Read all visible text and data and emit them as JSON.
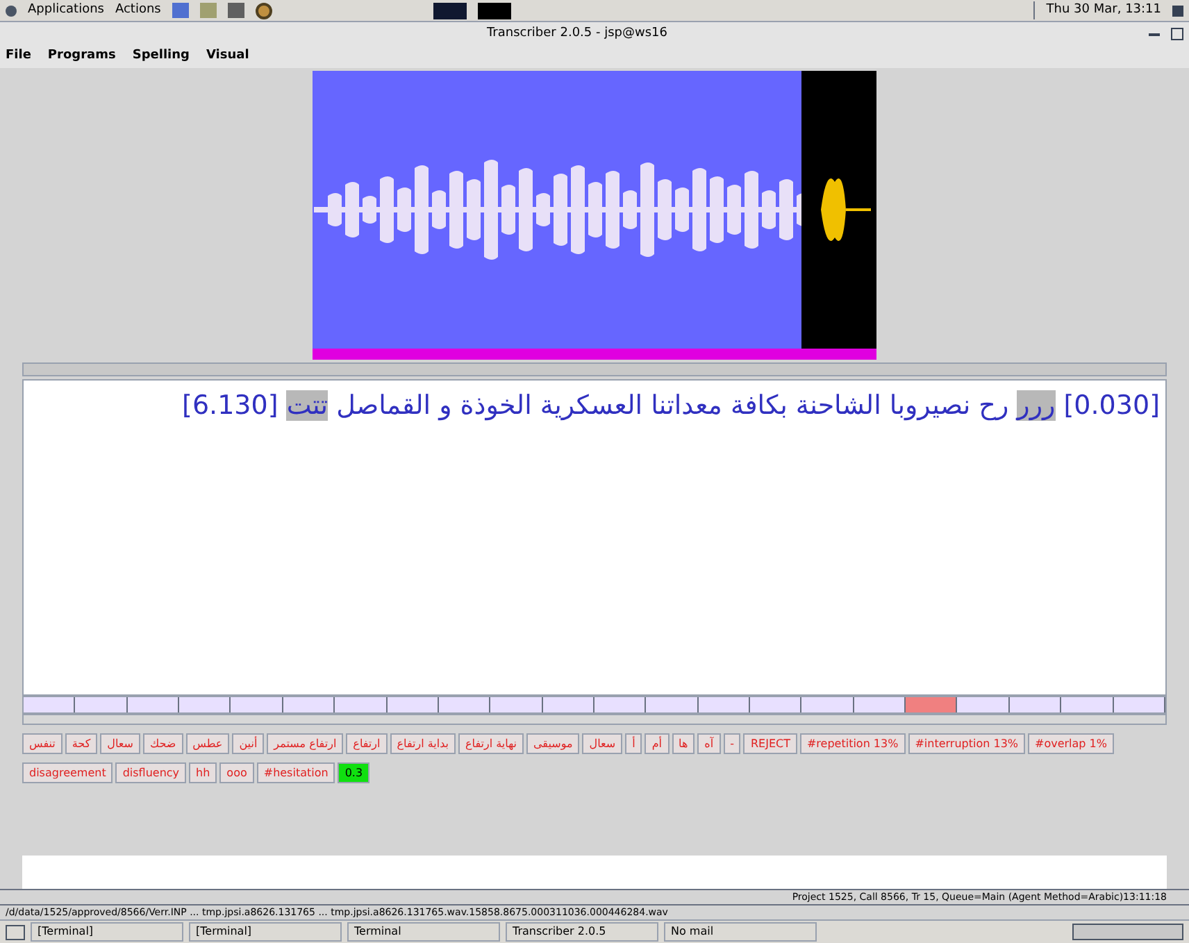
{
  "panel": {
    "menus": [
      "Actions",
      "Applications"
    ],
    "clock": "Thu 30 Mar, 13:11"
  },
  "window": {
    "title": "Transcriber 2.0.5 - jsp@ws16"
  },
  "menu": [
    "Visual",
    "Spelling",
    "Programs",
    "File"
  ],
  "transcript": {
    "start": "[0.030]",
    "noise_start": "ررر",
    "text": "رح نصيروبا الشاحنة بكافة معداتنا العسكرية الخوذة و القماصل",
    "noise_end": "تتت",
    "end": "[6.130]"
  },
  "segments": [
    {
      "selected": false
    },
    {
      "selected": false
    },
    {
      "selected": false
    },
    {
      "selected": false
    },
    {
      "selected": false
    },
    {
      "selected": false
    },
    {
      "selected": false
    },
    {
      "selected": false
    },
    {
      "selected": false
    },
    {
      "selected": false
    },
    {
      "selected": false
    },
    {
      "selected": false
    },
    {
      "selected": false
    },
    {
      "selected": false
    },
    {
      "selected": false
    },
    {
      "selected": false
    },
    {
      "selected": false
    },
    {
      "selected": true
    },
    {
      "selected": false
    },
    {
      "selected": false
    },
    {
      "selected": false
    },
    {
      "selected": false
    }
  ],
  "tag_rows": [
    [
      "#overlap 1%",
      "#interruption 13%",
      "#repetition 13%",
      "REJECT",
      "-",
      "آه",
      "ها",
      "أم",
      "أ",
      "سعال",
      "موسيقى",
      "نهاية ارتفاع",
      "بداية ارتفاع",
      "ارتفاع",
      "ارتفاع مستمر",
      "أنين",
      "عطس",
      "ضحك",
      "سعال",
      "كحة",
      "تنفس"
    ],
    [
      "0.3",
      "#hesitation",
      "ooo",
      "hh",
      "disfluency",
      "disagreement"
    ]
  ],
  "status_bar": {
    "project": "Project 1525, Call 8566, Tr 15, Queue=Main (Agent Method=Arabic)13:11:18",
    "path": "/d/data/1525/approved/8566/Verr.INP ... tmp.jpsi.a8626.131765 ... tmp.jpsi.a8626.131765.wav.15858.8675.000311036.000446284.wav"
  },
  "taskbar": [
    "No mail",
    "Transcriber 2.0.5",
    "Terminal",
    "[Terminal]",
    "[Terminal]"
  ]
}
